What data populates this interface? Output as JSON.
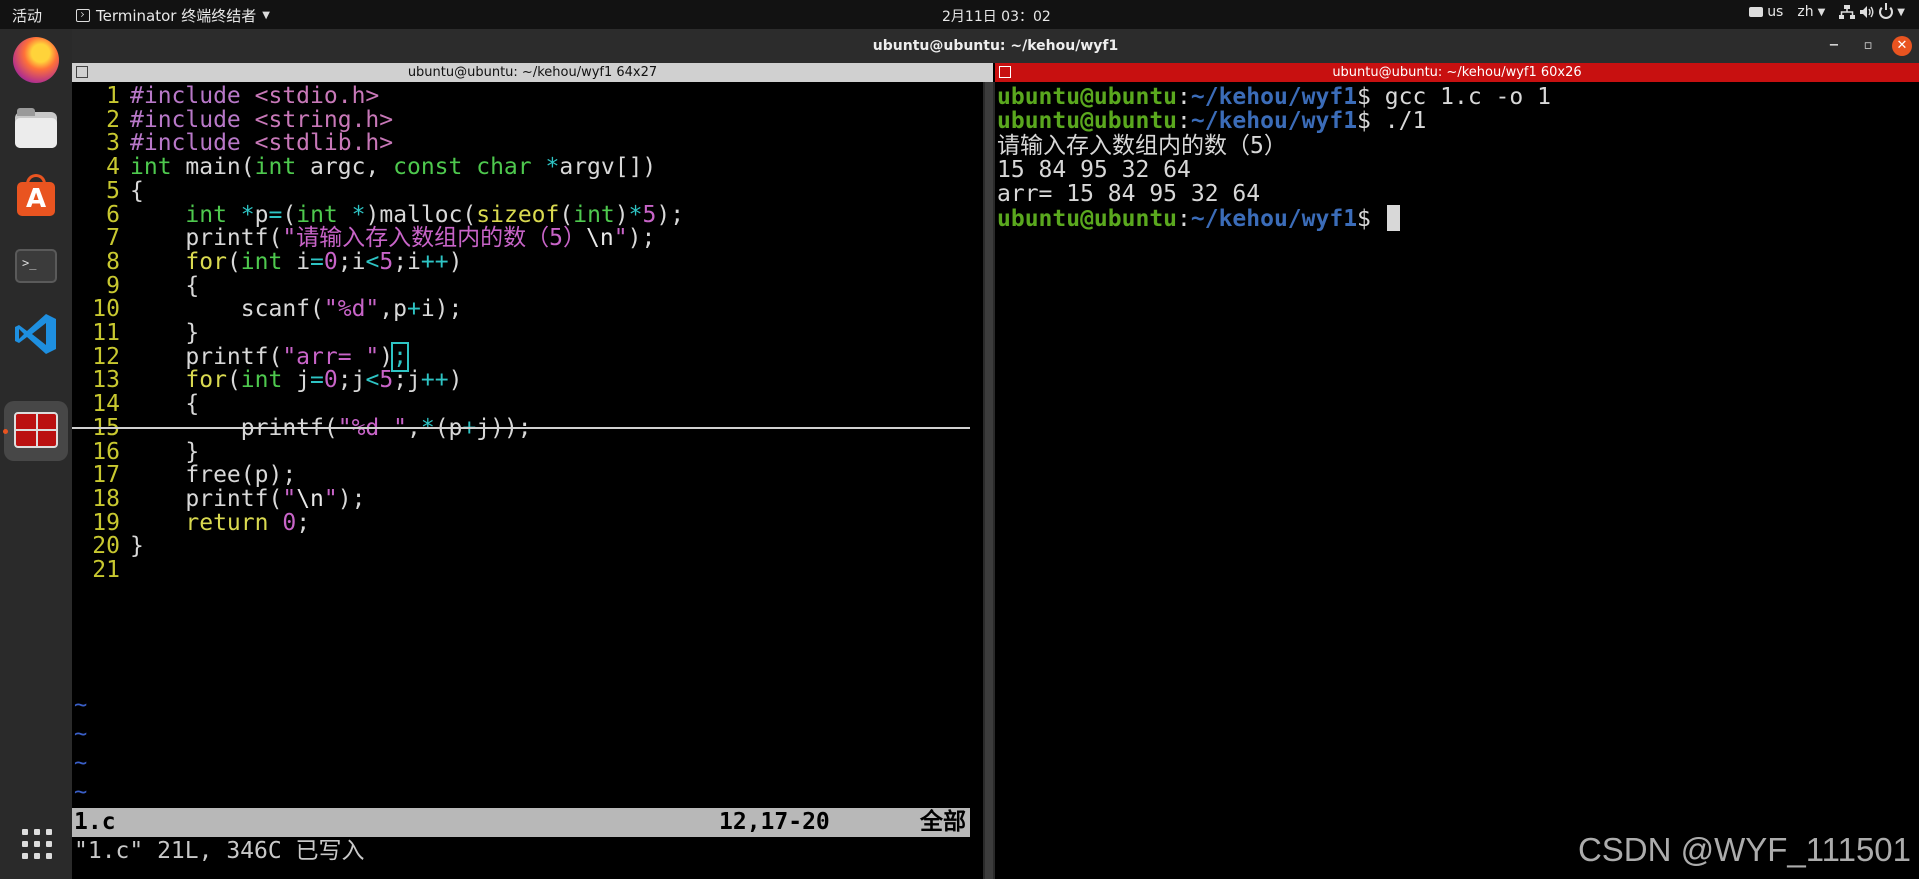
{
  "topbar": {
    "activities": "活动",
    "app_menu": "Terminator 终端终结者",
    "clock": "2月11日  03：02",
    "keyboard_layout": "us",
    "input_method": "zh"
  },
  "dock": {
    "items": [
      "firefox-icon",
      "files-icon",
      "software-store-icon",
      "terminal-icon",
      "vscode-icon",
      "terminator-icon"
    ],
    "active": "terminator-icon",
    "accent_color": "#e95420"
  },
  "window": {
    "title": "ubuntu@ubuntu: ~/kehou/wyf1",
    "minimize": "−",
    "maximize": "▫",
    "close": "✕"
  },
  "left_pane": {
    "title": "ubuntu@ubuntu: ~/kehou/wyf1 64x27"
  },
  "right_pane": {
    "title": "ubuntu@ubuntu: ~/kehou/wyf1 60x26",
    "title_color": "#c81010"
  },
  "vim": {
    "lines": [
      {
        "n": "1"
      },
      {
        "n": "2"
      },
      {
        "n": "3"
      },
      {
        "n": "4"
      },
      {
        "n": "5"
      },
      {
        "n": "6"
      },
      {
        "n": "7"
      },
      {
        "n": "8"
      },
      {
        "n": "9"
      },
      {
        "n": "10"
      },
      {
        "n": "11"
      },
      {
        "n": "12"
      },
      {
        "n": "13"
      },
      {
        "n": "14"
      },
      {
        "n": "15"
      },
      {
        "n": "16"
      },
      {
        "n": "17"
      },
      {
        "n": "18"
      },
      {
        "n": "19"
      },
      {
        "n": "20"
      },
      {
        "n": "21"
      }
    ],
    "code": {
      "l1": [
        "#include",
        " ",
        "<stdio.h>"
      ],
      "l2": [
        "#include",
        " ",
        "<string.h>"
      ],
      "l3": [
        "#include",
        " ",
        "<stdlib.h>"
      ],
      "l4": [
        "int",
        " main(",
        "int",
        " argc, ",
        "const",
        " ",
        "char",
        " ",
        "*",
        "argv[])"
      ],
      "l5": [
        "{"
      ],
      "l6": [
        "    ",
        "int",
        " ",
        "*",
        "p",
        "=",
        "(",
        "int",
        " ",
        "*",
        ")malloc(",
        "sizeof",
        "(",
        "int",
        ")",
        "*",
        "5",
        ");"
      ],
      "l7": [
        "    printf(",
        "\"请输入存入数组内的数（5）",
        "\\n",
        "\"",
        ");"
      ],
      "l8": [
        "    ",
        "for",
        "(",
        "int",
        " i",
        "=",
        "0",
        ";i",
        "<",
        "5",
        ";i",
        "++",
        ")"
      ],
      "l9": [
        "    {"
      ],
      "l10": [
        "        scanf(",
        "\"%d\"",
        ",p",
        "+",
        "i);"
      ],
      "l11": [
        "    }"
      ],
      "l12": [
        "    printf(",
        "\"arr= \"",
        ")",
        ";"
      ],
      "l13": [
        "    ",
        "for",
        "(",
        "int",
        " j",
        "=",
        "0",
        ";j",
        "<",
        "5",
        ";j",
        "++",
        ")"
      ],
      "l14": [
        "    {"
      ],
      "l15": [
        "        printf(",
        "\"%d \"",
        ",",
        "*",
        "(p",
        "+",
        "j));"
      ],
      "l16": [
        "    }"
      ],
      "l17": [
        "    free(p);"
      ],
      "l18": [
        "    printf(",
        "\"",
        "\\n",
        "\"",
        ");"
      ],
      "l19": [
        "    ",
        "return",
        " ",
        "0",
        ";"
      ],
      "l20": [
        "}"
      ],
      "l21": [
        ""
      ]
    },
    "tildes": [
      "~",
      "~",
      "~",
      "~"
    ],
    "status": {
      "filename": "1.c",
      "position": "12,17-20",
      "scroll": "全部"
    },
    "message": "\"1.c\" 21L, 346C 已写入"
  },
  "shell": {
    "lines": [
      {
        "user": "ubuntu@ubuntu",
        "sep": ":",
        "path": "~/kehou/wyf1",
        "prompt": "$ ",
        "cmd": "gcc 1.c -o 1"
      },
      {
        "user": "ubuntu@ubuntu",
        "sep": ":",
        "path": "~/kehou/wyf1",
        "prompt": "$ ",
        "cmd": "./1"
      },
      {
        "text": "请输入存入数组内的数（5）"
      },
      {
        "text": "15 84 95 32 64"
      },
      {
        "text": "arr= 15 84 95 32 64"
      },
      {
        "user": "ubuntu@ubuntu",
        "sep": ":",
        "path": "~/kehou/wyf1",
        "prompt": "$ ",
        "cmd": ""
      }
    ]
  },
  "watermark": "CSDN @WYF_111501"
}
